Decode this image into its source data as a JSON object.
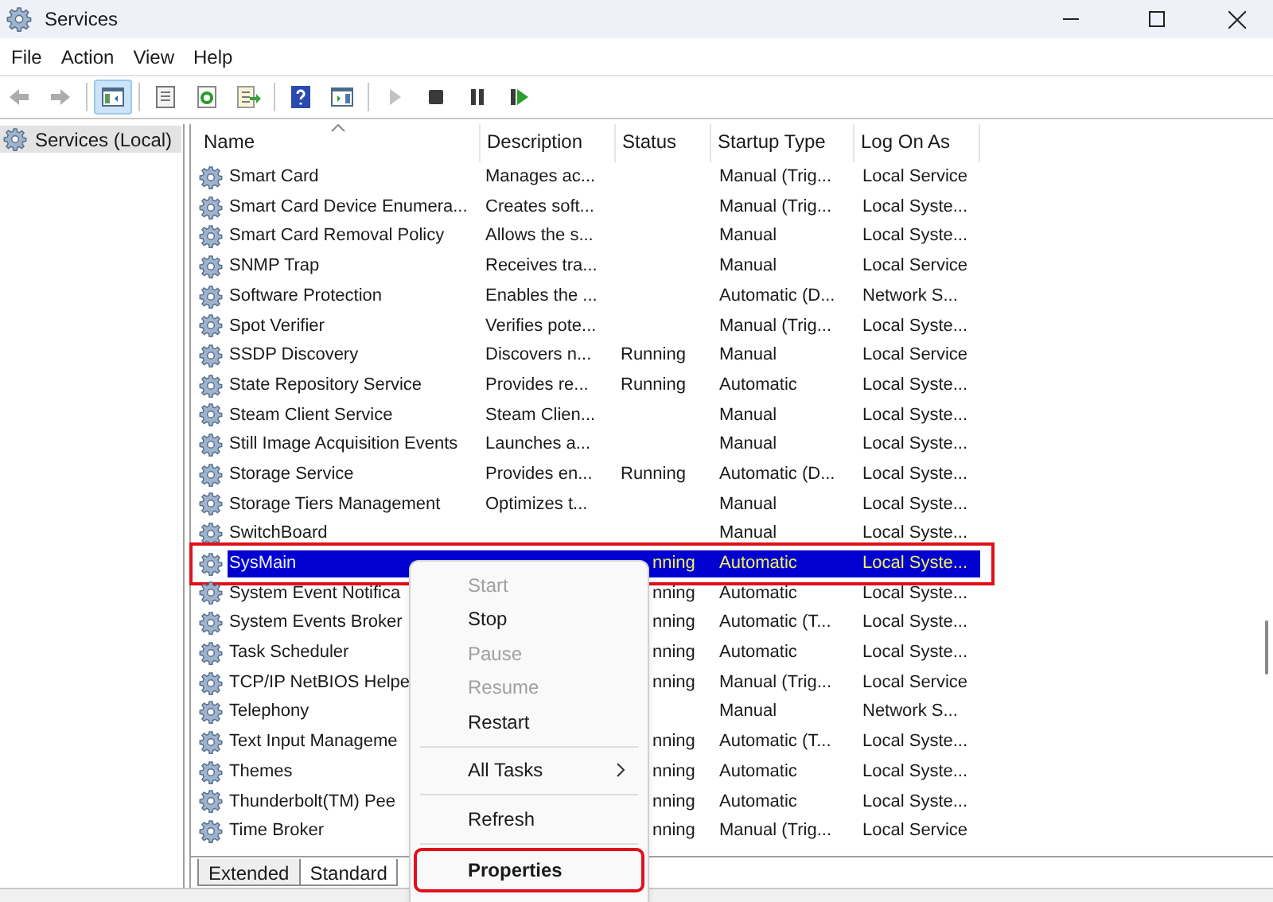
{
  "window": {
    "title": "Services"
  },
  "menu": [
    "File",
    "Action",
    "View",
    "Help"
  ],
  "toolbar": [
    {
      "kind": "back",
      "disabled": true,
      "selected": false
    },
    {
      "kind": "forward",
      "disabled": true,
      "selected": false
    },
    {
      "kind": "separator"
    },
    {
      "kind": "tree",
      "disabled": false,
      "selected": true
    },
    {
      "kind": "separator"
    },
    {
      "kind": "list",
      "disabled": false,
      "selected": false
    },
    {
      "kind": "refresh",
      "disabled": false,
      "selected": false
    },
    {
      "kind": "export",
      "disabled": false,
      "selected": false
    },
    {
      "kind": "separator"
    },
    {
      "kind": "help",
      "disabled": false,
      "selected": false
    },
    {
      "kind": "pane",
      "disabled": false,
      "selected": false
    },
    {
      "kind": "separator"
    },
    {
      "kind": "play",
      "disabled": true,
      "selected": false
    },
    {
      "kind": "stop",
      "disabled": false,
      "selected": false
    },
    {
      "kind": "pause",
      "disabled": false,
      "selected": false
    },
    {
      "kind": "resume",
      "disabled": false,
      "selected": false
    }
  ],
  "tree": [
    {
      "label": "Services (Local)",
      "selected": true
    }
  ],
  "columns": [
    {
      "label": "Name",
      "sorted": true
    },
    {
      "label": "Description",
      "sorted": false
    },
    {
      "label": "Status",
      "sorted": false
    },
    {
      "label": "Startup Type",
      "sorted": false
    },
    {
      "label": "Log On As",
      "sorted": false
    }
  ],
  "rows": [
    {
      "name": "Smart Card",
      "description": "Manages ac...",
      "startup": "Manual (Trig...",
      "logon": "Local Service",
      "selected": false,
      "annotated": false
    },
    {
      "name": "Smart Card Device Enumera...",
      "description": "Creates soft...",
      "startup": "Manual (Trig...",
      "logon": "Local Syste...",
      "selected": false,
      "annotated": false
    },
    {
      "name": "Smart Card Removal Policy",
      "description": "Allows the s...",
      "startup": "Manual",
      "logon": "Local Syste...",
      "selected": false,
      "annotated": false
    },
    {
      "name": "SNMP Trap",
      "description": "Receives tra...",
      "startup": "Manual",
      "logon": "Local Service",
      "selected": false,
      "annotated": false
    },
    {
      "name": "Software Protection",
      "description": "Enables the ...",
      "startup": "Automatic (D...",
      "logon": "Network S...",
      "selected": false,
      "annotated": false
    },
    {
      "name": "Spot Verifier",
      "description": "Verifies pote...",
      "startup": "Manual (Trig...",
      "logon": "Local Syste...",
      "selected": false,
      "annotated": false
    },
    {
      "name": "SSDP Discovery",
      "description": "Discovers n...",
      "status": "Running",
      "startup": "Manual",
      "logon": "Local Service",
      "selected": false,
      "annotated": false
    },
    {
      "name": "State Repository Service",
      "description": "Provides re...",
      "status": "Running",
      "startup": "Automatic",
      "logon": "Local Syste...",
      "selected": false,
      "annotated": false
    },
    {
      "name": "Steam Client Service",
      "description": "Steam Clien...",
      "startup": "Manual",
      "logon": "Local Syste...",
      "selected": false,
      "annotated": false
    },
    {
      "name": "Still Image Acquisition Events",
      "description": "Launches a...",
      "startup": "Manual",
      "logon": "Local Syste...",
      "selected": false,
      "annotated": false
    },
    {
      "name": "Storage Service",
      "description": "Provides en...",
      "status": "Running",
      "startup": "Automatic (D...",
      "logon": "Local Syste...",
      "selected": false,
      "annotated": false
    },
    {
      "name": "Storage Tiers Management",
      "description": "Optimizes t...",
      "startup": "Manual",
      "logon": "Local Syste...",
      "selected": false,
      "annotated": false
    },
    {
      "name": "SwitchBoard",
      "startup": "Manual",
      "logon": "Local Syste...",
      "selected": false,
      "annotated": false
    },
    {
      "name": "SysMain",
      "status": "nning",
      "status_cut": true,
      "startup": "Automatic",
      "logon": "Local Syste...",
      "selected": true,
      "annotated": true
    },
    {
      "name": "System Event Notifica",
      "status": "nning",
      "status_cut": true,
      "startup": "Automatic",
      "logon": "Local Syste...",
      "selected": false,
      "annotated": false
    },
    {
      "name": "System Events Broker",
      "status": "nning",
      "status_cut": true,
      "startup": "Automatic (T...",
      "logon": "Local Syste...",
      "selected": false,
      "annotated": false
    },
    {
      "name": "Task Scheduler",
      "status": "nning",
      "status_cut": true,
      "startup": "Automatic",
      "logon": "Local Syste...",
      "selected": false,
      "annotated": false
    },
    {
      "name": "TCP/IP NetBIOS Helpe",
      "status": "nning",
      "status_cut": true,
      "startup": "Manual (Trig...",
      "logon": "Local Service",
      "selected": false,
      "annotated": false
    },
    {
      "name": "Telephony",
      "startup": "Manual",
      "logon": "Network S...",
      "selected": false,
      "annotated": false
    },
    {
      "name": "Text Input Manageme",
      "status": "nning",
      "status_cut": true,
      "startup": "Automatic (T...",
      "logon": "Local Syste...",
      "selected": false,
      "annotated": false
    },
    {
      "name": "Themes",
      "status": "nning",
      "status_cut": true,
      "startup": "Automatic",
      "logon": "Local Syste...",
      "selected": false,
      "annotated": false
    },
    {
      "name": "Thunderbolt(TM) Pee",
      "status": "nning",
      "status_cut": true,
      "startup": "Automatic",
      "logon": "Local Syste...",
      "selected": false,
      "annotated": false
    },
    {
      "name": "Time Broker",
      "status": "nning",
      "status_cut": true,
      "startup": "Manual (Trig...",
      "logon": "Local Service",
      "selected": false,
      "annotated": false
    }
  ],
  "tabs": [
    {
      "label": "Extended",
      "selected": false
    },
    {
      "label": "Standard",
      "selected": true
    }
  ],
  "context_menu": [
    {
      "kind": "item",
      "label": "Start",
      "disabled": true,
      "default": false,
      "annotated": false
    },
    {
      "kind": "item",
      "label": "Stop",
      "disabled": false,
      "default": false,
      "annotated": false
    },
    {
      "kind": "item",
      "label": "Pause",
      "disabled": true,
      "default": false,
      "annotated": false
    },
    {
      "kind": "item",
      "label": "Resume",
      "disabled": true,
      "default": false,
      "annotated": false
    },
    {
      "kind": "item",
      "label": "Restart",
      "disabled": false,
      "default": false,
      "annotated": false
    },
    {
      "kind": "separator"
    },
    {
      "kind": "submenu",
      "label": "All Tasks",
      "disabled": false,
      "default": false,
      "annotated": false
    },
    {
      "kind": "separator"
    },
    {
      "kind": "item",
      "label": "Refresh",
      "disabled": false,
      "default": false,
      "annotated": false
    },
    {
      "kind": "separator"
    },
    {
      "kind": "item",
      "label": "Properties",
      "disabled": false,
      "default": true,
      "annotated": true
    }
  ]
}
